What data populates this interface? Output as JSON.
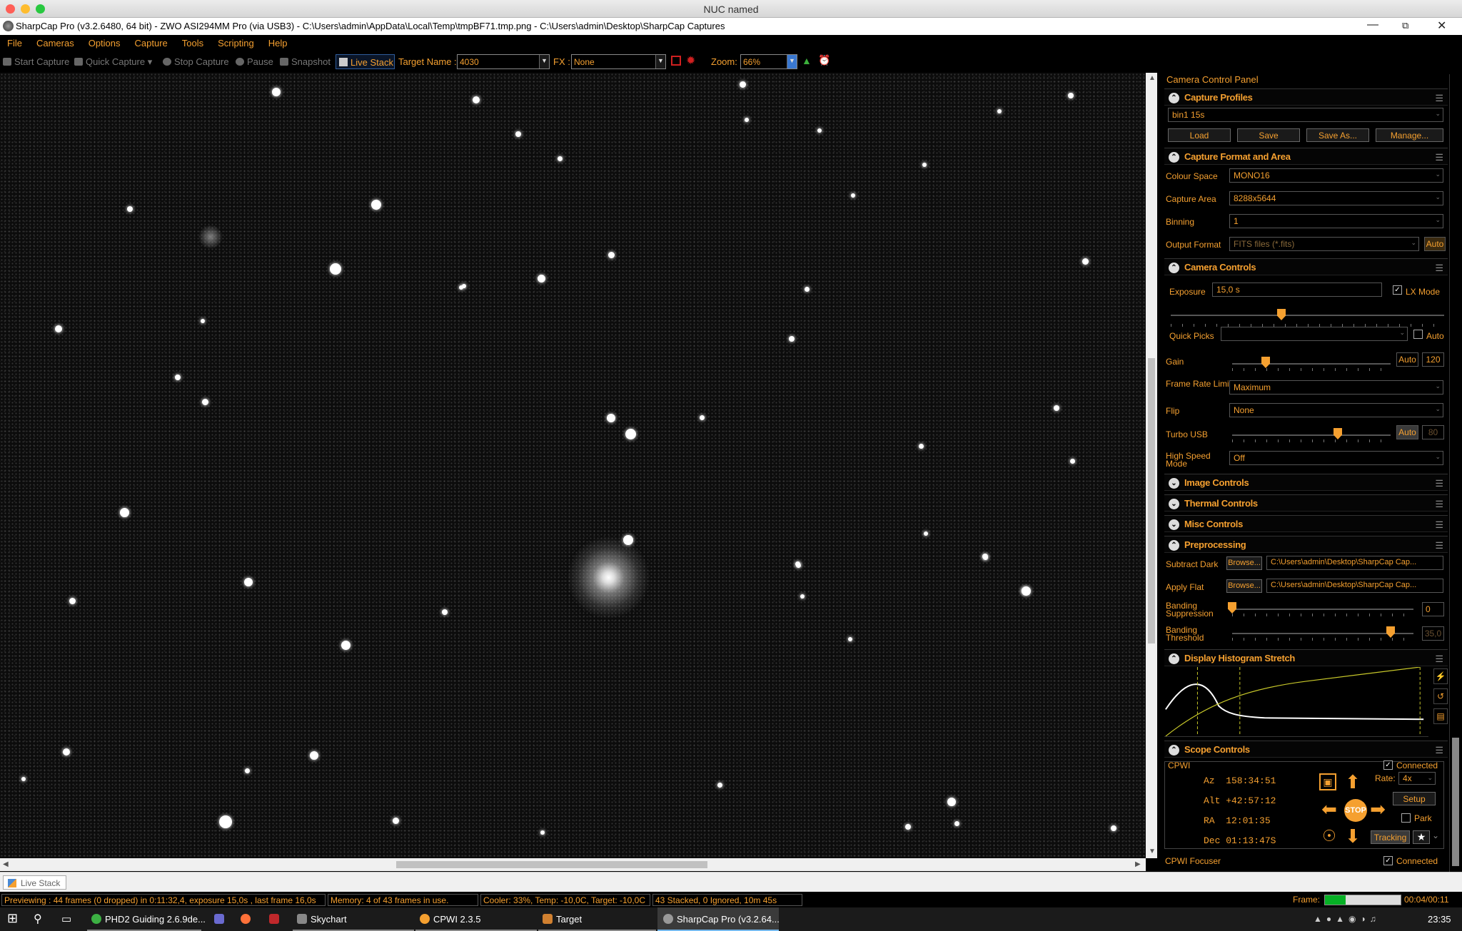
{
  "mac_window_title": "NUC named",
  "app_title": "SharpCap Pro (v3.2.6480, 64 bit) - ZWO ASI294MM Pro (via USB3) - C:\\Users\\admin\\AppData\\Local\\Temp\\tmpBF71.tmp.png - C:\\Users\\admin\\Desktop\\SharpCap Captures",
  "menu": [
    "File",
    "Cameras",
    "Options",
    "Capture",
    "Tools",
    "Scripting",
    "Help"
  ],
  "toolbar": {
    "start_capture": "Start Capture",
    "quick_capture": "Quick Capture",
    "stop_capture": "Stop Capture",
    "pause": "Pause",
    "snapshot": "Snapshot",
    "live_stack": "Live Stack",
    "target_name_label": "Target Name :",
    "target_name_value": "4030",
    "fx_label": "FX :",
    "fx_value": "None",
    "zoom_label": "Zoom:",
    "zoom_value": "66%"
  },
  "panel": {
    "title": "Camera Control Panel",
    "capture_profiles": {
      "title": "Capture Profiles",
      "profile": "bin1 15s",
      "buttons": [
        "Load",
        "Save",
        "Save As...",
        "Manage..."
      ]
    },
    "capture_format": {
      "title": "Capture Format and Area",
      "colour_space_label": "Colour Space",
      "colour_space": "MONO16",
      "capture_area_label": "Capture Area",
      "capture_area": "8288x5644",
      "binning_label": "Binning",
      "binning": "1",
      "output_format_label": "Output Format",
      "output_format": "FITS files (*.fits)",
      "auto": "Auto"
    },
    "camera_controls": {
      "title": "Camera Controls",
      "exposure_label": "Exposure",
      "exposure": "15,0 s",
      "lx_mode": "LX Mode",
      "quick_picks_label": "Quick Picks",
      "quick_picks_auto": "Auto",
      "gain_label": "Gain",
      "gain_auto": "Auto",
      "gain": "120",
      "frame_rate_label": "Frame Rate Limit",
      "frame_rate": "Maximum",
      "flip_label": "Flip",
      "flip": "None",
      "turbo_label": "Turbo USB",
      "turbo_auto": "Auto",
      "turbo": "80",
      "high_speed_label": "High Speed Mode",
      "high_speed": "Off"
    },
    "collapsed_sections": [
      "Image Controls",
      "Thermal Controls",
      "Misc Controls"
    ],
    "preprocessing": {
      "title": "Preprocessing",
      "subtract_dark_label": "Subtract Dark",
      "browse": "Browse...",
      "dark_path": "C:\\Users\\admin\\Desktop\\SharpCap Cap...",
      "apply_flat_label": "Apply Flat",
      "flat_path": "C:\\Users\\admin\\Desktop\\SharpCap Cap...",
      "banding_supp_label": "Banding Suppression",
      "banding_supp": "0",
      "banding_thresh_label": "Banding Threshold",
      "banding_thresh": "35,0"
    },
    "histogram": {
      "title": "Display Histogram Stretch"
    },
    "scope": {
      "title": "Scope Controls",
      "mount": "CPWI",
      "connected": "Connected",
      "az": "Az  158:34:51",
      "alt": "Alt +42:57:12",
      "ra": "RA  12:01:35",
      "dec": "Dec 01:13:47S",
      "rate_label": "Rate:",
      "rate": "4x",
      "setup": "Setup",
      "park": "Park",
      "tracking": "Tracking",
      "stop": "STOP",
      "focuser": "CPWI Focuser",
      "focuser_connected": "Connected"
    }
  },
  "tab": "Live Stack",
  "status": {
    "previewing": "Previewing : 44 frames (0 dropped) in 0:11:32,4, exposure 15,0s , last frame 16,0s",
    "memory": "Memory: 4 of 43 frames in use.",
    "cooler": "Cooler: 33%, Temp: -10,0C, Target: -10,0C",
    "stacked": "43 Stacked, 0 Ignored, 10m 45s",
    "frame_label": "Frame:",
    "frame_progress": 0.27,
    "frame_time": "00:04/00:11"
  },
  "taskbar": {
    "apps": [
      "PHD2 Guiding 2.6.9de...",
      "Skychart",
      "CPWI 2.3.5",
      "Target",
      "SharpCap Pro (v3.2.64..."
    ],
    "clock": "23:35"
  }
}
